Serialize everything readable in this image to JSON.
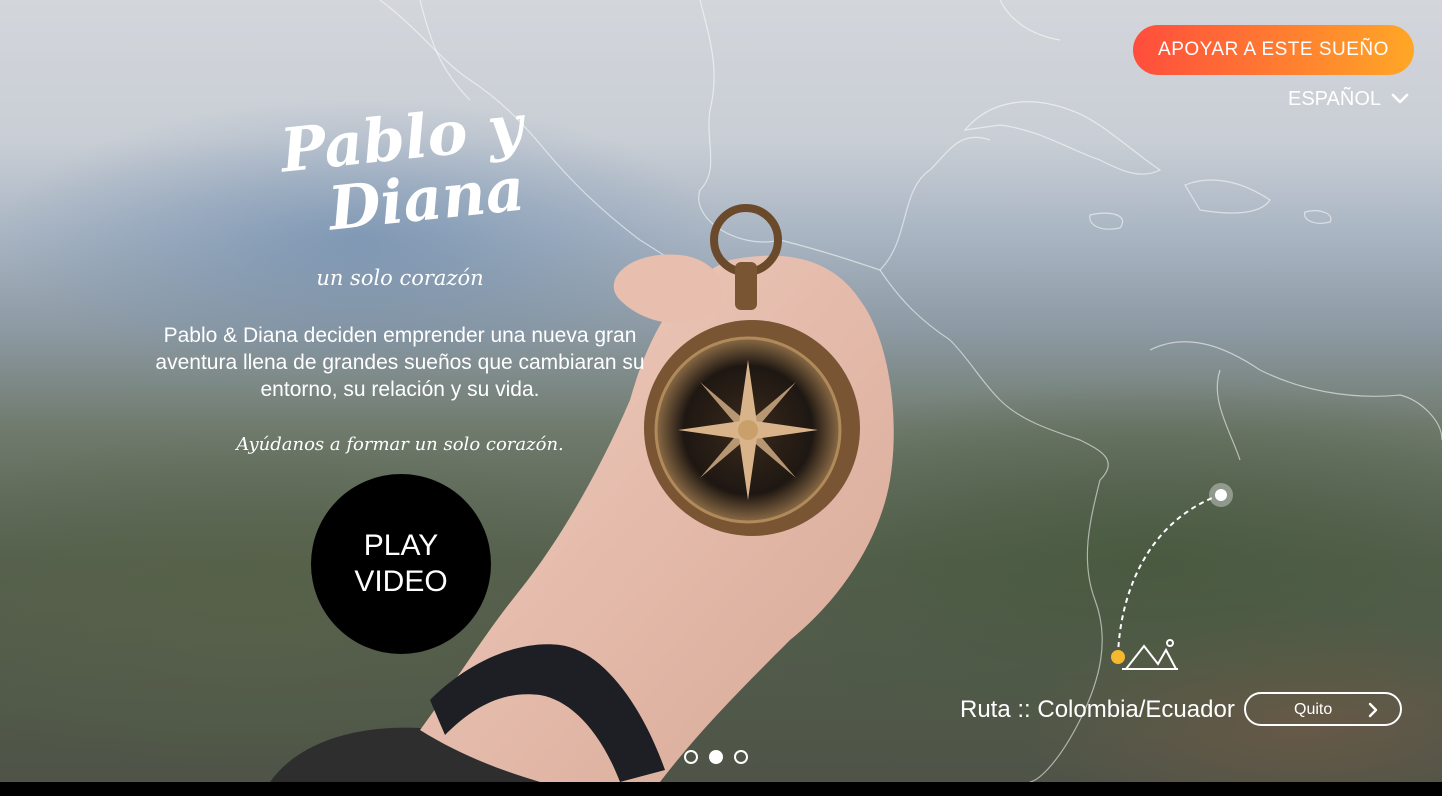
{
  "header": {
    "support_button": "APOYAR A ESTE SUEÑO",
    "language": "ESPAÑOL"
  },
  "hero": {
    "logo_line1": "Pablo y",
    "logo_line2": "Diana",
    "tagline": "un solo corazón",
    "intro": "Pablo & Diana deciden emprender una nueva gran aventura llena de grandes sueños que cambiaran su entorno, su relación y su vida.",
    "cta": "Ayúdanos a formar un solo corazón.",
    "play_line1": "PLAY",
    "play_line2": "VIDEO"
  },
  "route": {
    "label": "Ruta :: Colombia/Ecuador",
    "destination": "Quito"
  },
  "carousel": {
    "total": 3,
    "active": 2
  },
  "colors": {
    "support_gradient_start": "#ff4d3d",
    "support_gradient_end": "#ffa726",
    "route_start_marker": "#f5b82e",
    "play_button": "#000000"
  },
  "icons": {
    "language_toggle": "chevron-down-icon",
    "route_next": "chevron-right-icon",
    "mountain": "mountain-icon"
  }
}
